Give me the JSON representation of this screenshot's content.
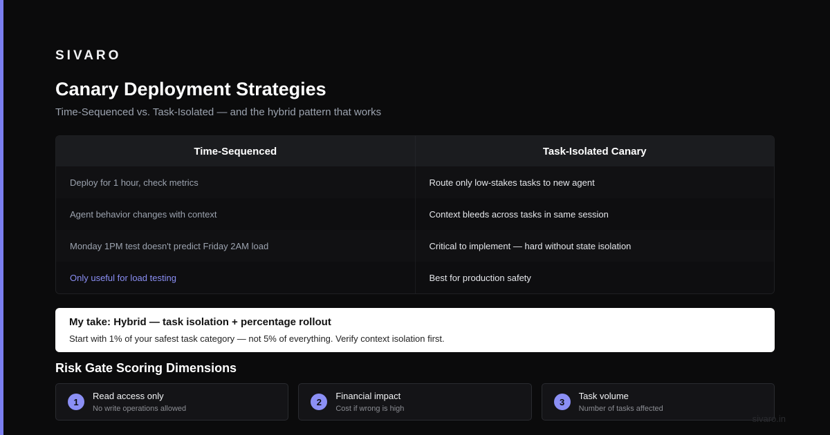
{
  "brand": "SIVARO",
  "title": "Canary Deployment Strategies",
  "subtitle": "Time-Sequenced vs. Task-Isolated — and the hybrid pattern that works",
  "comparison": {
    "headers": [
      "Time-Sequenced",
      "Task-Isolated Canary"
    ],
    "rows": [
      [
        "Deploy for 1 hour, check metrics",
        "Route only low-stakes tasks to new agent"
      ],
      [
        "Agent behavior changes with context",
        "Context bleeds across tasks in same session"
      ],
      [
        "Monday 1PM test doesn't predict Friday 2AM load",
        "Critical to implement — hard without state isolation"
      ],
      [
        "Only useful for load testing",
        "Best for production safety"
      ]
    ]
  },
  "take": {
    "title": "My take: Hybrid — task isolation + percentage rollout",
    "body": "Start with 1% of your safest task category — not 5% of everything. Verify context isolation first."
  },
  "risk_section": {
    "title": "Risk Gate Scoring Dimensions",
    "cards": [
      {
        "num": "1",
        "title": "Read access only",
        "sub": "No write operations allowed"
      },
      {
        "num": "2",
        "title": "Financial impact",
        "sub": "Cost if wrong is high"
      },
      {
        "num": "3",
        "title": "Task volume",
        "sub": "Number of tasks affected"
      }
    ]
  },
  "footer": "sivaro.in",
  "colors": {
    "accent": "#7b7ff0",
    "background": "#0b0b0c"
  }
}
